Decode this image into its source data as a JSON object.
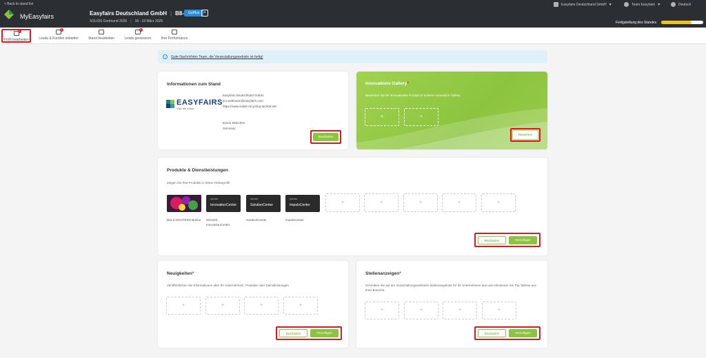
{
  "header": {
    "back_link": "< Back to stand list",
    "app_title": "MyEasyfairs",
    "company": "Easyfairs Deutschland GmbH",
    "stand": "B8-7A",
    "plan": "GoPlus",
    "plan_plus": "+",
    "event": "SOLIDS Dortmund 2026",
    "dates": "18 - 19 März 2026",
    "right_company": "Easyfairs Deutschland GmbH",
    "team": "Team Easyfairs",
    "language": "Deutsch",
    "progress_label": "Fertigstellung des Standes",
    "progress_fraction": 0.72
  },
  "tabs": [
    {
      "label": "Profil bearbeiten",
      "badge": "1"
    },
    {
      "label": "Leads & Kunden einladen",
      "badge": "2"
    },
    {
      "label": "Stand bearbeiten",
      "badge": ""
    },
    {
      "label": "Leads generieren",
      "badge": "1"
    },
    {
      "label": "Ihre Performance",
      "badge": ""
    }
  ],
  "banner": {
    "text": "Gute Nachrichten Team, die Veranstaltungswebsite ist fertig!"
  },
  "stand_info": {
    "title": "Informationen zum Stand",
    "logo_word": "EASYFAIRS",
    "logo_sub": "Visit the future",
    "company": "Easyfairs Deutschland GmbH",
    "email": "tim.weltmann@easyfairs.com",
    "website": "https://www.solids-recycling-technik.de/",
    "zip_city": "81541 München",
    "country": "Germany",
    "edit_button": "Bearbeiten"
  },
  "gallery": {
    "title": "Innovations Gallery",
    "desc": "Bewerben Sie Ihr innovativsten Produkt in unserer Innovation Gallery",
    "apply_button": "Bewerben",
    "slot_symbol": "+"
  },
  "products": {
    "title": "Produkte & Dienstleistungen",
    "desc": "Zeigen Sie Ihre Produkte in Ihrem Onlineprofil",
    "items": [
      {
        "name": "BULK-MASTERS Bühne",
        "thumb": ""
      },
      {
        "name": "SOLIDS InnovationCenter",
        "thumb": "InnovationCenter",
        "mini": "SOLIDS"
      },
      {
        "name": "SolutionCenter",
        "thumb": "SolutionCenter",
        "mini": "SOLIDS"
      },
      {
        "name": "ImpulsCenter",
        "thumb": "ImpulsCenter",
        "mini": "SOLIDS"
      }
    ],
    "edit_button": "Bearbeiten",
    "add_button": "Hinzufügen",
    "slot_symbol": "+"
  },
  "news": {
    "title": "Neuigkeiten",
    "desc": "Veröffentlichen Sie Informationen über Ihr Unternehmen, Produkte oder Dienstleistungen.",
    "edit_button": "Bearbeiten",
    "add_button": "Hinzufügen",
    "slot_symbol": "+"
  },
  "jobs": {
    "title": "Stellenanzeigen",
    "desc": "Schreiben Sie auf der Veranstaltungswebseite Stellenangebote für Ihr Unternehmen aus und rekrutieren Sie Top Talente aus Ihrer Branche.",
    "edit_button": "Bearbeiten",
    "add_button": "Hinzufügen",
    "slot_symbol": "+"
  },
  "colors": {
    "header_bg": "#2b2e33",
    "accent_green": "#8cc43f",
    "highlight_red": "#e0171c",
    "plan_blue": "#2c8cd6",
    "progress_yellow": "#f2c215"
  }
}
